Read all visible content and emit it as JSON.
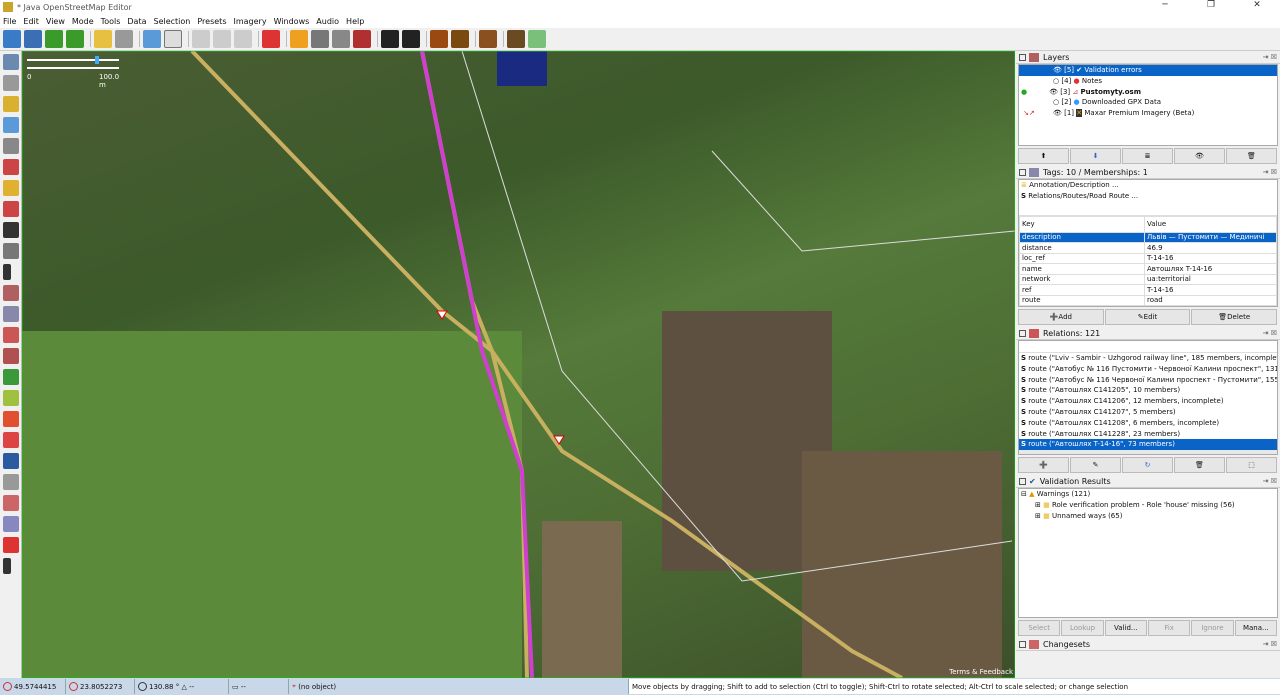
{
  "window": {
    "title": "* Java OpenStreetMap Editor",
    "minimize": "─",
    "maximize": "❐",
    "close": "✕"
  },
  "menu": [
    "File",
    "Edit",
    "View",
    "Mode",
    "Tools",
    "Data",
    "Selection",
    "Presets",
    "Imagery",
    "Windows",
    "Audio",
    "Help"
  ],
  "map": {
    "scale_start": "0",
    "scale_end": "100.0 m",
    "attribution": "Terms & Feedback"
  },
  "layers": {
    "title": "Layers",
    "items": [
      {
        "index": "[5]",
        "name": "Validation errors",
        "selected": true,
        "visible": true
      },
      {
        "index": "[4]",
        "name": "Notes",
        "visible": false
      },
      {
        "index": "[3]",
        "name": "Pustomyty.osm",
        "visible": true,
        "active": true
      },
      {
        "index": "[2]",
        "name": "Downloaded GPX Data",
        "visible": false
      },
      {
        "index": "[1]",
        "name": "Maxar Premium Imagery (Beta)",
        "visible": true
      }
    ]
  },
  "tags": {
    "title": "Tags: 10 / Memberships: 1",
    "presets": [
      "Annotation/Description ...",
      "Relations/Routes/Road Route ..."
    ],
    "col_key": "Key",
    "col_value": "Value",
    "rows": [
      [
        "description",
        "Львів — Пустомити — Мединичі"
      ],
      [
        "distance",
        "46.9"
      ],
      [
        "loc_ref",
        "T-14-16"
      ],
      [
        "name",
        "Автошлях T-14-16"
      ],
      [
        "network",
        "ua:territorial"
      ],
      [
        "ref",
        "T-14-16"
      ],
      [
        "route",
        "road"
      ]
    ],
    "add": "Add",
    "edit": "Edit",
    "delete": "Delete"
  },
  "relations": {
    "title": "Relations: 121",
    "items": [
      "route (\"Lviv - Sambir - Uzhgorod railway line\", 185 members, incomplete)",
      "route (\"Автобус № 116 Пустомити - Червоної Калини проспект\", 131 m",
      "route (\"Автобус № 116 Червоної Калини проспект - Пустомити\", 155 m",
      "route (\"Автошлях C141205\", 10 members)",
      "route (\"Автошлях C141206\", 12 members, incomplete)",
      "route (\"Автошлях C141207\", 5 members)",
      "route (\"Автошлях C141208\", 6 members, incomplete)",
      "route (\"Автошлях C141228\", 23 members)",
      "route (\"Автошлях T-14-16\", 73 members)"
    ],
    "selected_index": 8
  },
  "validation": {
    "title": "Validation Results",
    "root": "Warnings (121)",
    "children": [
      "Role verification problem - Role 'house' missing (56)",
      "Unnamed ways (65)"
    ],
    "buttons": [
      "Select",
      "Lookup",
      "Valid...",
      "Fix",
      "Ignore",
      "Mana..."
    ]
  },
  "changesets": {
    "title": "Changesets"
  },
  "status": {
    "lat": "49.5744415",
    "lon": "23.8052273",
    "heading": "130.88 °",
    "angle": "--",
    "distance": "--",
    "object": "(no object)",
    "help": "Move objects by dragging; Shift to add to selection (Ctrl to toggle); Shift-Ctrl to rotate selected; Alt-Ctrl to scale selected; or change selection"
  }
}
